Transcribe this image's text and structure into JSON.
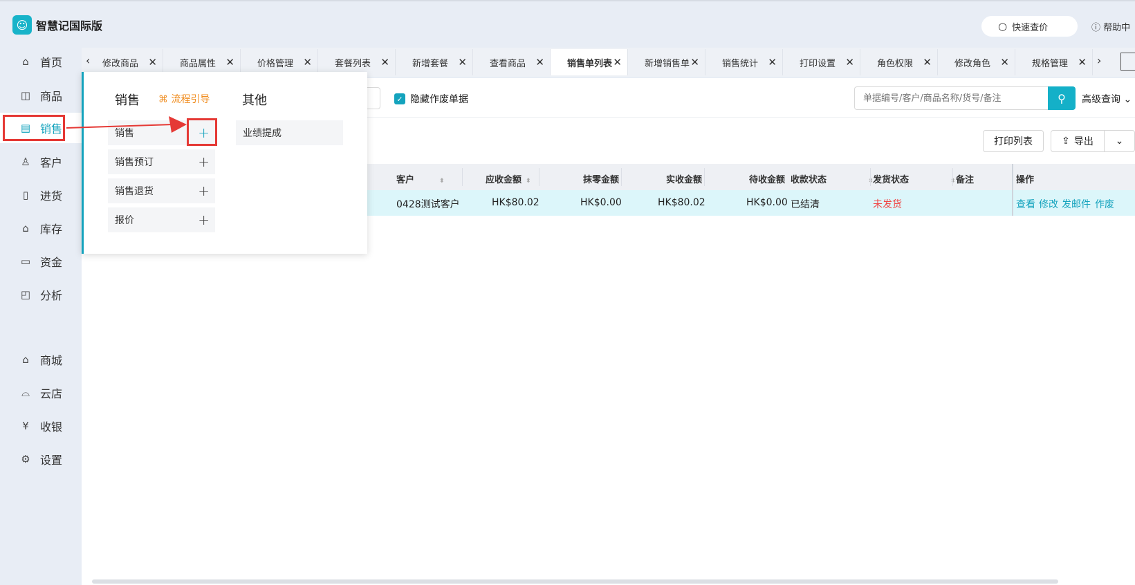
{
  "app": {
    "title": "智慧记国际版"
  },
  "header": {
    "quick_price": "快速查价",
    "help": "帮助中"
  },
  "sidebar": {
    "items": [
      {
        "label": "首页",
        "icon": "home-icon"
      },
      {
        "label": "商品",
        "icon": "bag-icon"
      },
      {
        "label": "销售",
        "icon": "clipboard-icon",
        "active": true
      },
      {
        "label": "客户",
        "icon": "user-icon"
      },
      {
        "label": "进货",
        "icon": "book-icon"
      },
      {
        "label": "库存",
        "icon": "warehouse-icon"
      },
      {
        "label": "资金",
        "icon": "wallet-icon"
      },
      {
        "label": "分析",
        "icon": "chart-icon"
      },
      {
        "label": "商城",
        "icon": "shop-icon"
      },
      {
        "label": "云店",
        "icon": "store-icon"
      },
      {
        "label": "收银",
        "icon": "cashier-icon"
      },
      {
        "label": "设置",
        "icon": "gear-icon"
      }
    ]
  },
  "tabs": [
    {
      "label": "修改商品"
    },
    {
      "label": "商品属性"
    },
    {
      "label": "价格管理"
    },
    {
      "label": "套餐列表"
    },
    {
      "label": "新增套餐"
    },
    {
      "label": "查看商品"
    },
    {
      "label": "销售单列表",
      "active": true
    },
    {
      "label": "新增销售单"
    },
    {
      "label": "销售统计"
    },
    {
      "label": "打印设置"
    },
    {
      "label": "角色权限"
    },
    {
      "label": "修改角色"
    },
    {
      "label": "规格管理"
    }
  ],
  "toolbar": {
    "hide_void_label": "隐藏作废单据",
    "search_placeholder": "单据编号/客户/商品名称/货号/备注",
    "advanced_query": "高级查询",
    "print_list": "打印列表",
    "export": "导出"
  },
  "table": {
    "headers": [
      "客户",
      "应收金额",
      "抹零金额",
      "实收金额",
      "待收金额",
      "收款状态",
      "发货状态",
      "备注",
      "操作"
    ],
    "rows": [
      {
        "customer": "0428测试客户",
        "receivable": "HK$80.02",
        "rounding": "HK$0.00",
        "received": "HK$80.02",
        "pending": "HK$0.00",
        "payment_status": "已结清",
        "shipping_status": "未发货",
        "note": "",
        "actions": [
          "查看",
          "修改",
          "发邮件",
          "作废"
        ]
      }
    ]
  },
  "popup": {
    "sales_heading": "销售",
    "guide": "流程引导",
    "other_heading": "其他",
    "sales_items": [
      "销售",
      "销售预订",
      "销售退货",
      "报价"
    ],
    "other_items": [
      "业绩提成"
    ]
  },
  "colors": {
    "accent": "#14a3bd",
    "highlight": "#e53935",
    "warning": "#f08c1e"
  }
}
